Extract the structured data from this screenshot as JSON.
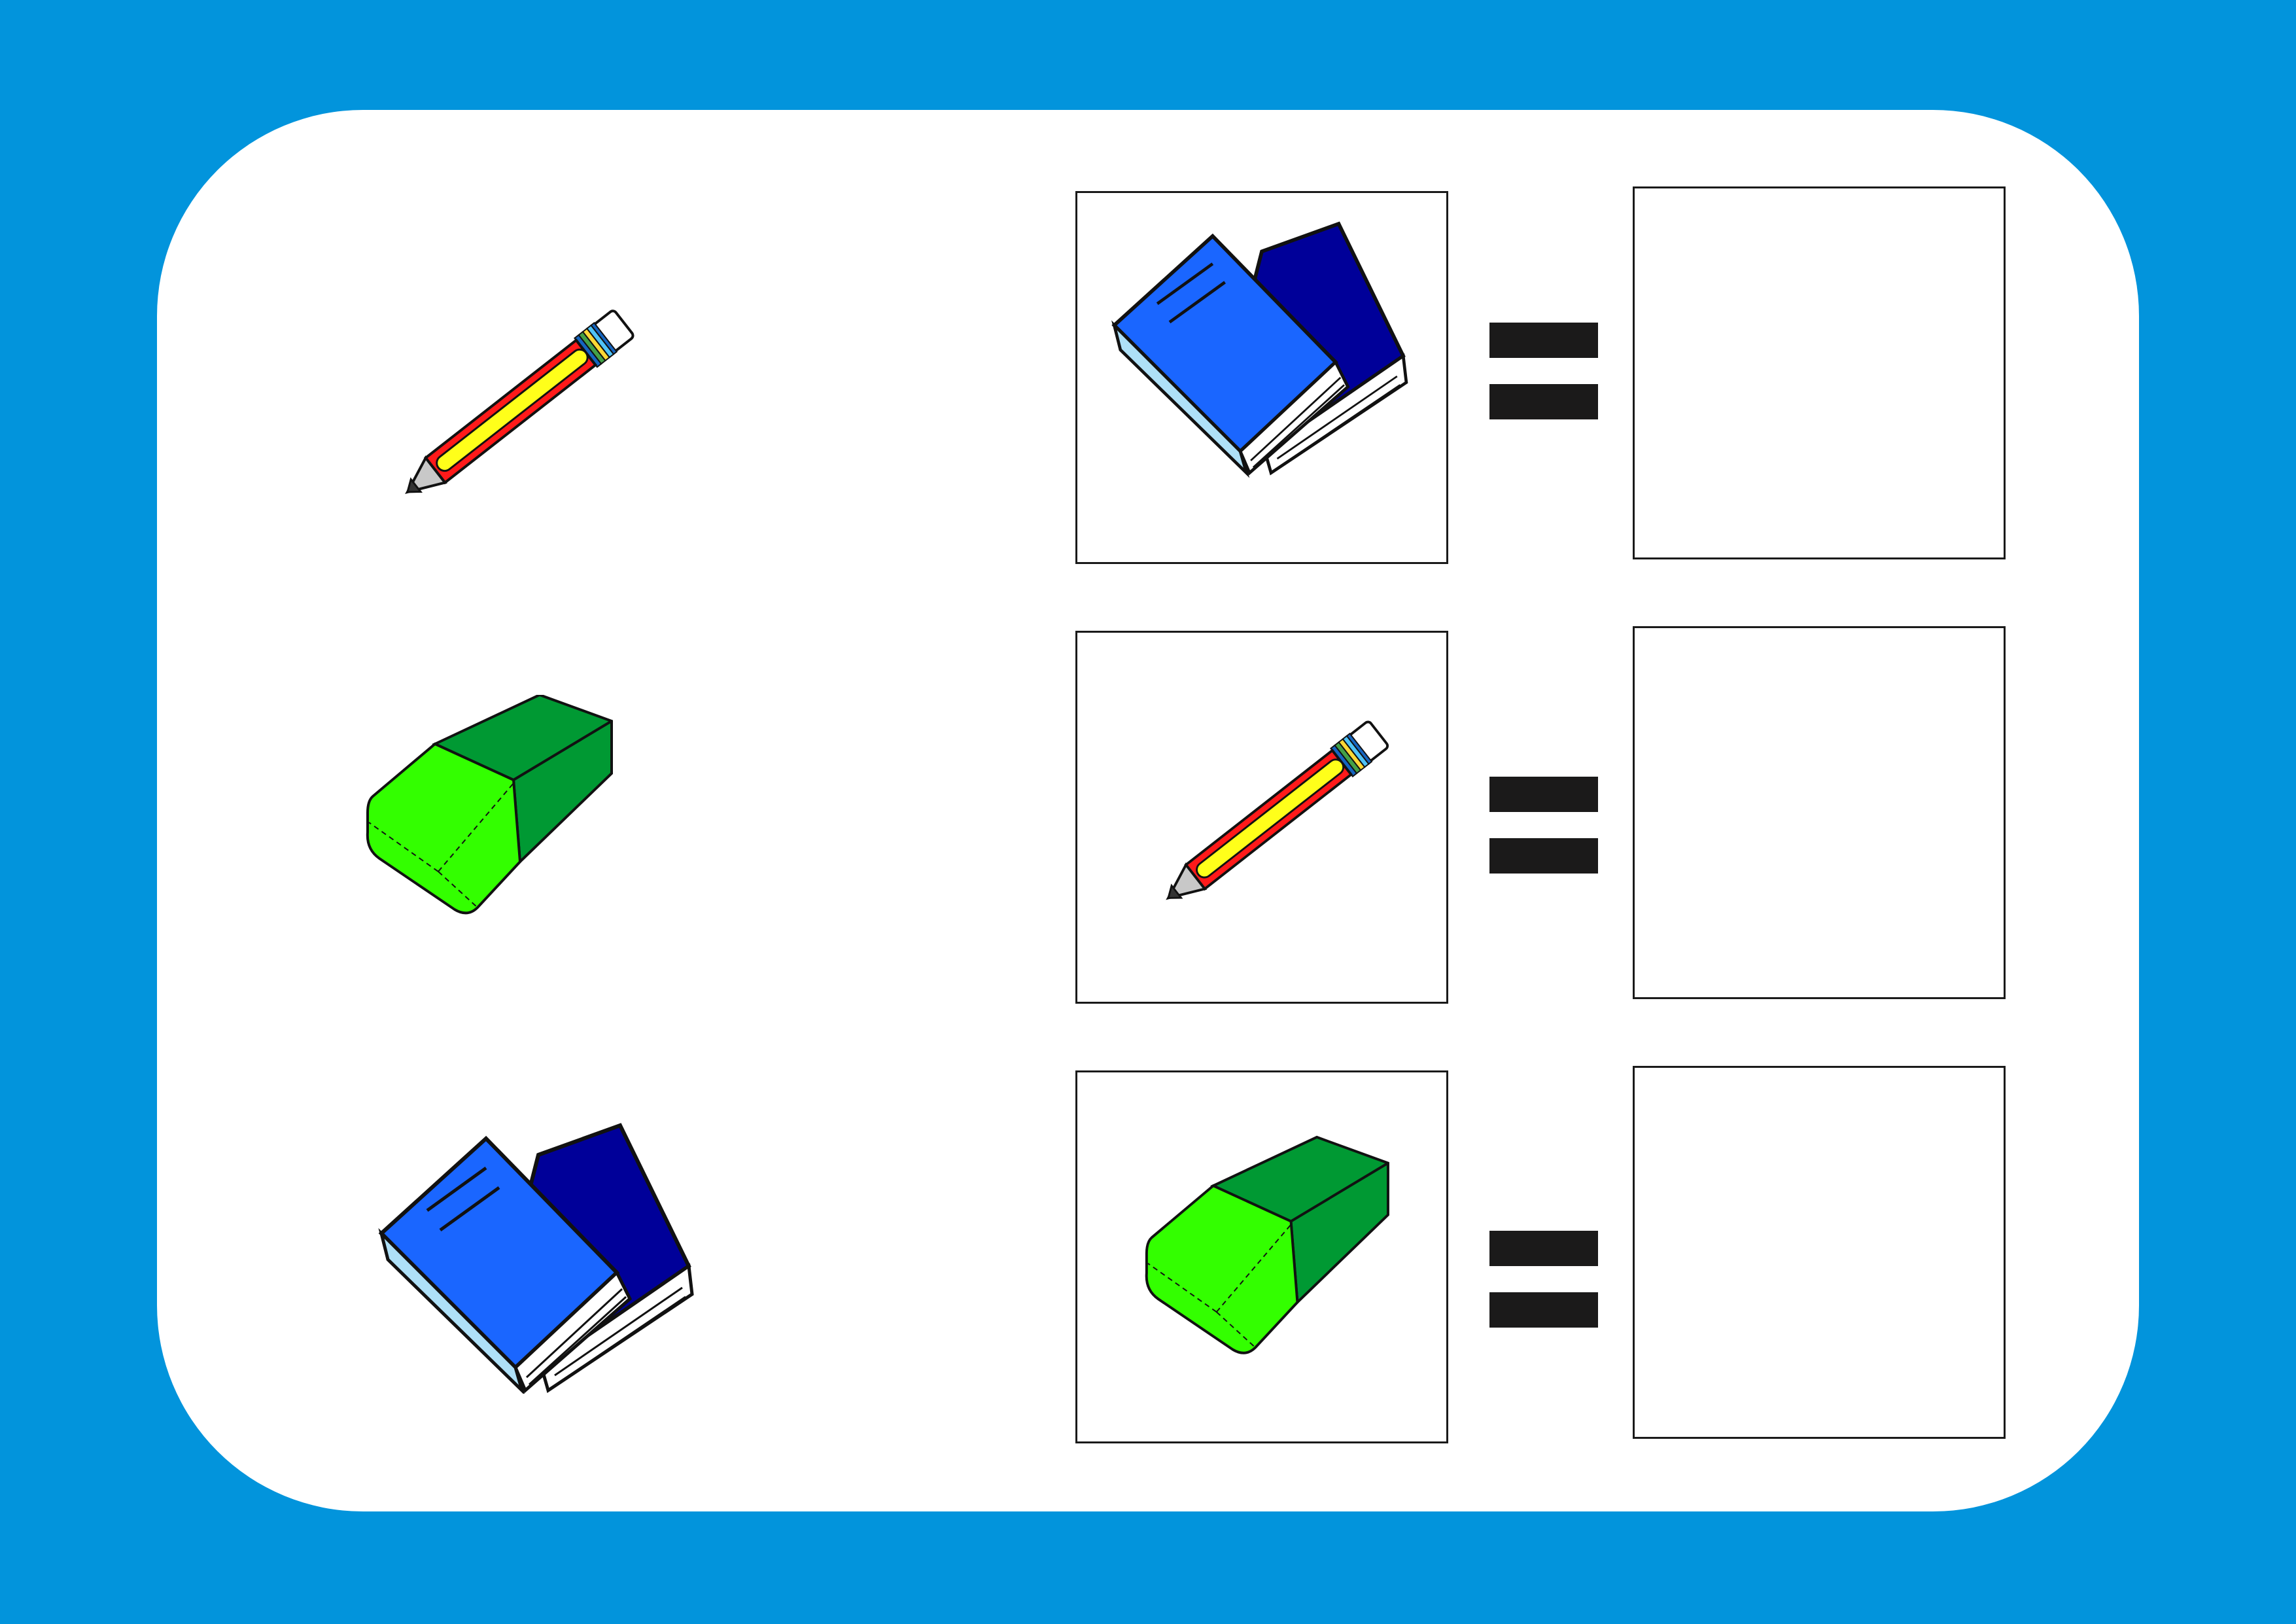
{
  "colors": {
    "frame": "#0294dc",
    "card": "#ffffff",
    "equals": "#1b1a1a",
    "box_border": "#1a1a1a"
  },
  "left_column": [
    {
      "icon": "pencil-icon"
    },
    {
      "icon": "eraser-icon"
    },
    {
      "icon": "books-icon"
    }
  ],
  "equations": [
    {
      "clue_icon": "books-icon",
      "symbol": "equals-sign",
      "answer": ""
    },
    {
      "clue_icon": "pencil-icon",
      "symbol": "equals-sign",
      "answer": ""
    },
    {
      "clue_icon": "eraser-icon",
      "symbol": "equals-sign",
      "answer": ""
    }
  ]
}
